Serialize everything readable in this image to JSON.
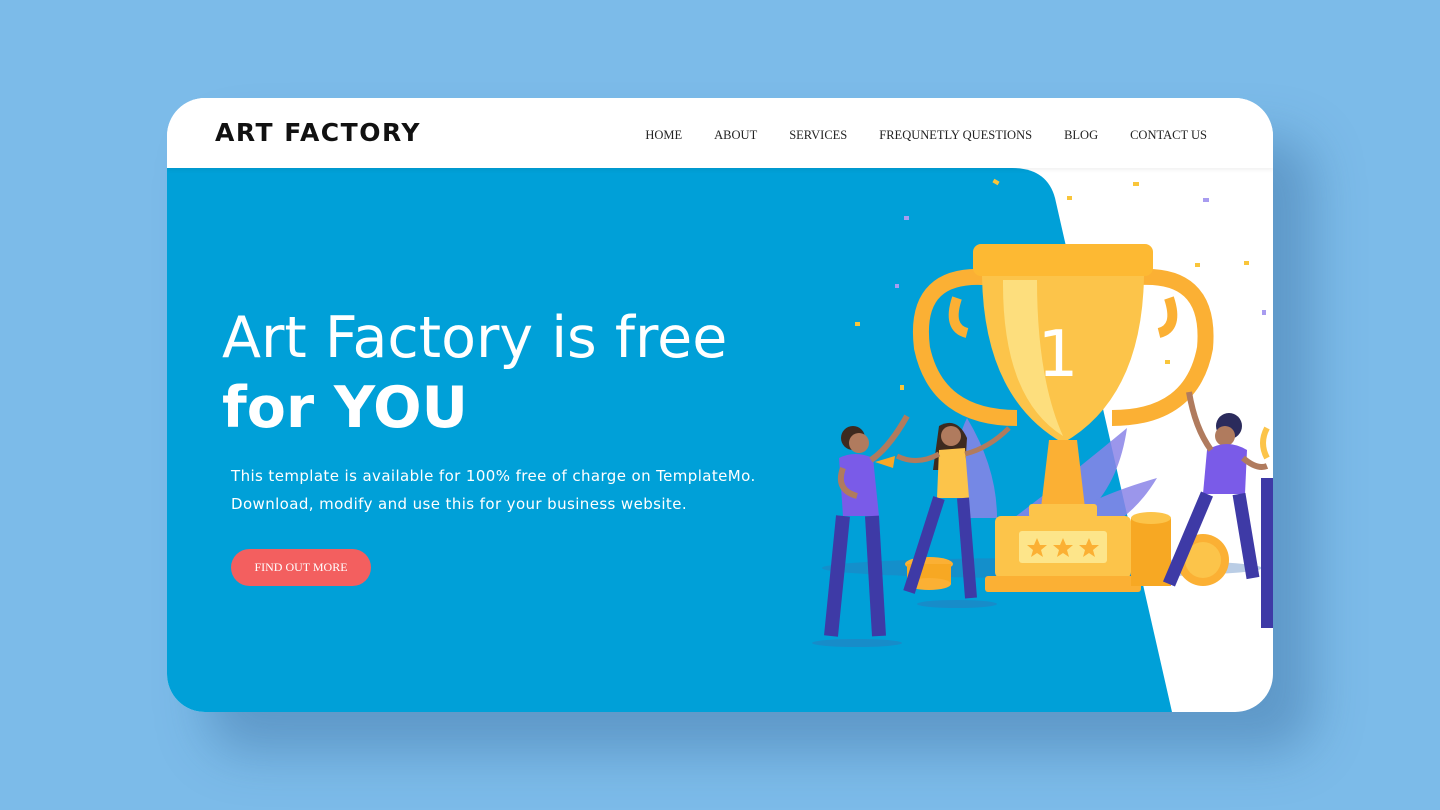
{
  "brand": {
    "logo": "ART FACTORY"
  },
  "nav": {
    "items": [
      "HOME",
      "ABOUT",
      "SERVICES",
      "FREQUNETLY QUESTIONS",
      "BLOG",
      "CONTACT US"
    ]
  },
  "hero": {
    "title_line1": "Art Factory is free",
    "title_line2": "for YOU",
    "desc_line1": "This template is available for 100% free of charge on TemplateMo.",
    "desc_line2": "Download, modify and use this for your business website.",
    "cta_label": "FIND OUT MORE",
    "trophy_number": "1"
  },
  "colors": {
    "page_bg": "#7cbbe9",
    "hero_bg": "#00a0d8",
    "cta_bg": "#f35f5f",
    "trophy_gold": "#fcc44a"
  }
}
